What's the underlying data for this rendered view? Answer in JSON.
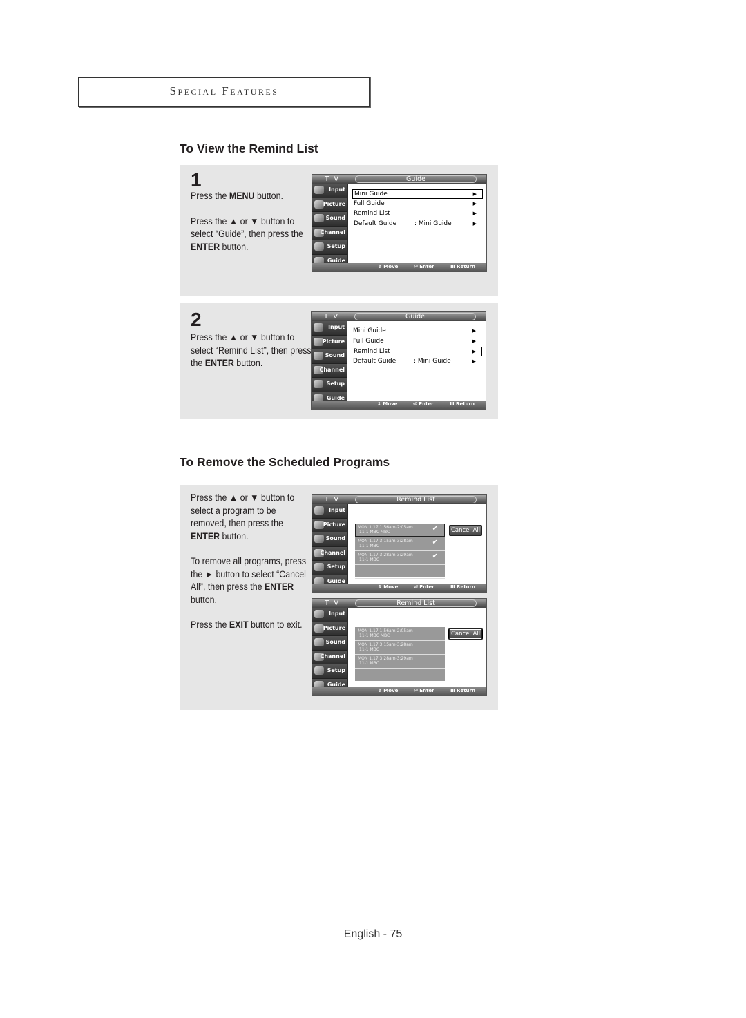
{
  "section_title": "Special Features",
  "headings": {
    "view_remind": "To View the Remind List",
    "remove_scheduled": "To Remove the Scheduled Programs"
  },
  "steps": [
    {
      "number": "1",
      "paragraphs": [
        [
          "Press the ",
          {
            "b": "MENU"
          },
          " button."
        ],
        [
          "Press the ▲ or ▼ button to select “Guide”, then press the ",
          {
            "b": "ENTER"
          },
          " button."
        ]
      ]
    },
    {
      "number": "2",
      "paragraphs": [
        [
          "Press the ▲ or ▼ button to select “Remind List”, then press the ",
          {
            "b": "ENTER"
          },
          " button."
        ]
      ]
    }
  ],
  "remove_text": [
    [
      "Press the ▲ or ▼ button to select a program to be removed, then press the ",
      {
        "b": "ENTER"
      },
      " button."
    ],
    [
      "To remove all programs, press the ► button to select “Cancel All”, then press the ",
      {
        "b": "ENTER"
      },
      " button."
    ],
    [
      "Press the ",
      {
        "b": "EXIT"
      },
      " button to exit."
    ]
  ],
  "tv": {
    "label": "T V",
    "sidebar": [
      "Input",
      "Picture",
      "Sound",
      "Channel",
      "Setup",
      "Guide"
    ],
    "hints": {
      "move": "⇕ Move",
      "enter": "⏎ Enter",
      "return": "Ⅲ Return"
    },
    "guide_title": "Guide",
    "guide_menu": [
      {
        "label": "Mini Guide",
        "value": ""
      },
      {
        "label": "Full Guide",
        "value": ""
      },
      {
        "label": "Remind List",
        "value": ""
      },
      {
        "label": "Default Guide",
        "value": ":   Mini Guide"
      }
    ],
    "remind_title": "Remind List",
    "cancel_all": "Cancel All",
    "remind_items": [
      {
        "line1": "MON 1.17 1:56am-2:05am",
        "line2": "11-1  MBC      MBC",
        "check": "✔"
      },
      {
        "line1": "MON 1.17 3:15am-3:28am",
        "line2": "11-1  MBC",
        "check": "✔"
      },
      {
        "line1": "MON 1.17 3:28am-3:29am",
        "line2": "11-1  MBC",
        "check": "✔"
      }
    ]
  },
  "footer": "English - 75"
}
